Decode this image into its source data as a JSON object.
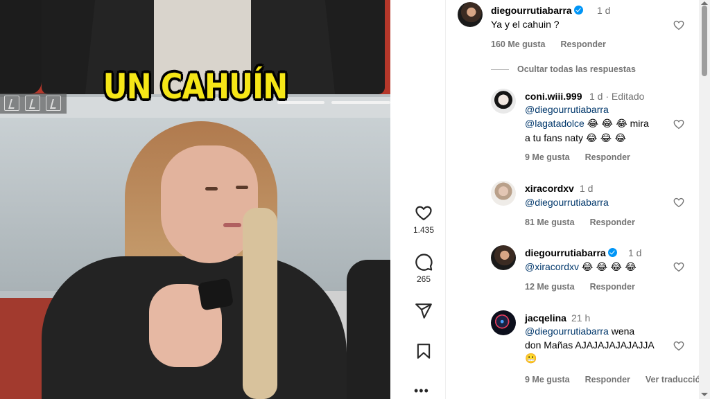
{
  "video": {
    "caption": "UN CAHUÍN"
  },
  "actions": {
    "like_count": "1.435",
    "comment_count": "265"
  },
  "comments": [
    {
      "user": "diegourrutiabarra",
      "verified": true,
      "time": "1 d",
      "text": "Ya y el cahuin ?",
      "likes": "160 Me gusta",
      "reply": "Responder"
    },
    {
      "user": "coni.wiii.999",
      "time": "1 d · Editado",
      "mention1": "@diegourrutiabarra",
      "mention2": "@lagatadolce",
      "emoji": "😂 😂 😂",
      "text_after": "mira",
      "line2": "a tu fans naty",
      "emoji2": "😂 😂 😂",
      "likes": "9 Me gusta",
      "reply": "Responder"
    },
    {
      "user": "xiracordxv",
      "time": "1 d",
      "mention1": "@diegourrutiabarra",
      "likes": "81 Me gusta",
      "reply": "Responder"
    },
    {
      "user": "diegourrutiabarra",
      "verified": true,
      "time": "1 d",
      "mention1": "@xiracordxv",
      "emoji": "😂 😂 😂 😂",
      "likes": "12 Me gusta",
      "reply": "Responder"
    },
    {
      "user": "jacqelina",
      "time": "21 h",
      "mention1": "@diegourrutiabarra",
      "text_after": "wena",
      "line2": "don Mañas AJAJAJAJAJAJJA",
      "emoji2": "😬",
      "likes": "9 Me gusta",
      "reply": "Responder",
      "translate": "Ver traducción"
    }
  ],
  "hide_replies": "Ocultar todas las respuestas",
  "more_label": "•••",
  "colors": {
    "mention": "#00376b",
    "meta": "#737373",
    "caption": "#f5e617",
    "verified": "#0095f6"
  },
  "icons": [
    "heart-icon",
    "comment-icon",
    "share-icon",
    "bookmark-icon",
    "more-icon",
    "verified-icon"
  ]
}
